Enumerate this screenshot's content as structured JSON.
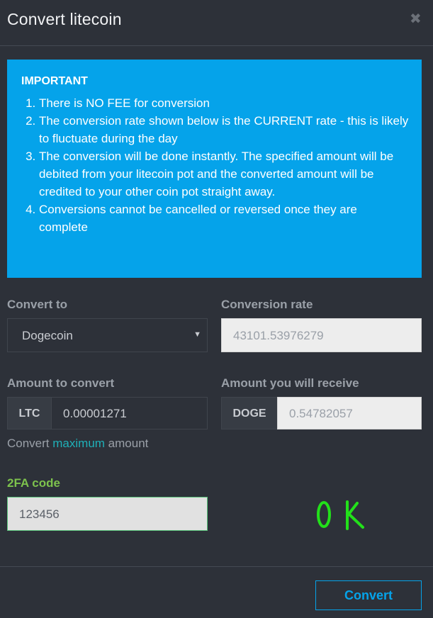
{
  "modal": {
    "title": "Convert litecoin",
    "close_symbol": "✖"
  },
  "notice": {
    "heading": "IMPORTANT",
    "items": [
      "There is NO FEE for conversion",
      "The conversion rate shown below is the CURRENT rate - this is likely to fluctuate during the day",
      "The conversion will be done instantly. The specified amount will be debited from your litecoin pot and the converted amount will be credited to your other coin pot straight away.",
      "Conversions cannot be cancelled or reversed once they are complete"
    ],
    "background_color": "#05a3ea"
  },
  "form": {
    "convert_to_label": "Convert to",
    "convert_to_value": "Dogecoin",
    "rate_label": "Conversion rate",
    "rate_value": "43101.53976279",
    "amount_label": "Amount to convert",
    "amount_currency": "LTC",
    "amount_value": "0.00001271",
    "receive_label": "Amount you will receive",
    "receive_currency": "DOGE",
    "receive_value": "0.54782057",
    "convert_prefix": "Convert",
    "convert_link": "maximum",
    "convert_suffix": "amount",
    "twofa_label": "2FA code",
    "twofa_value": "123456"
  },
  "annotation": {
    "text": "OK",
    "color": "#22e01a"
  },
  "footer": {
    "convert_button": "Convert",
    "accent_color": "#05a3ea"
  }
}
